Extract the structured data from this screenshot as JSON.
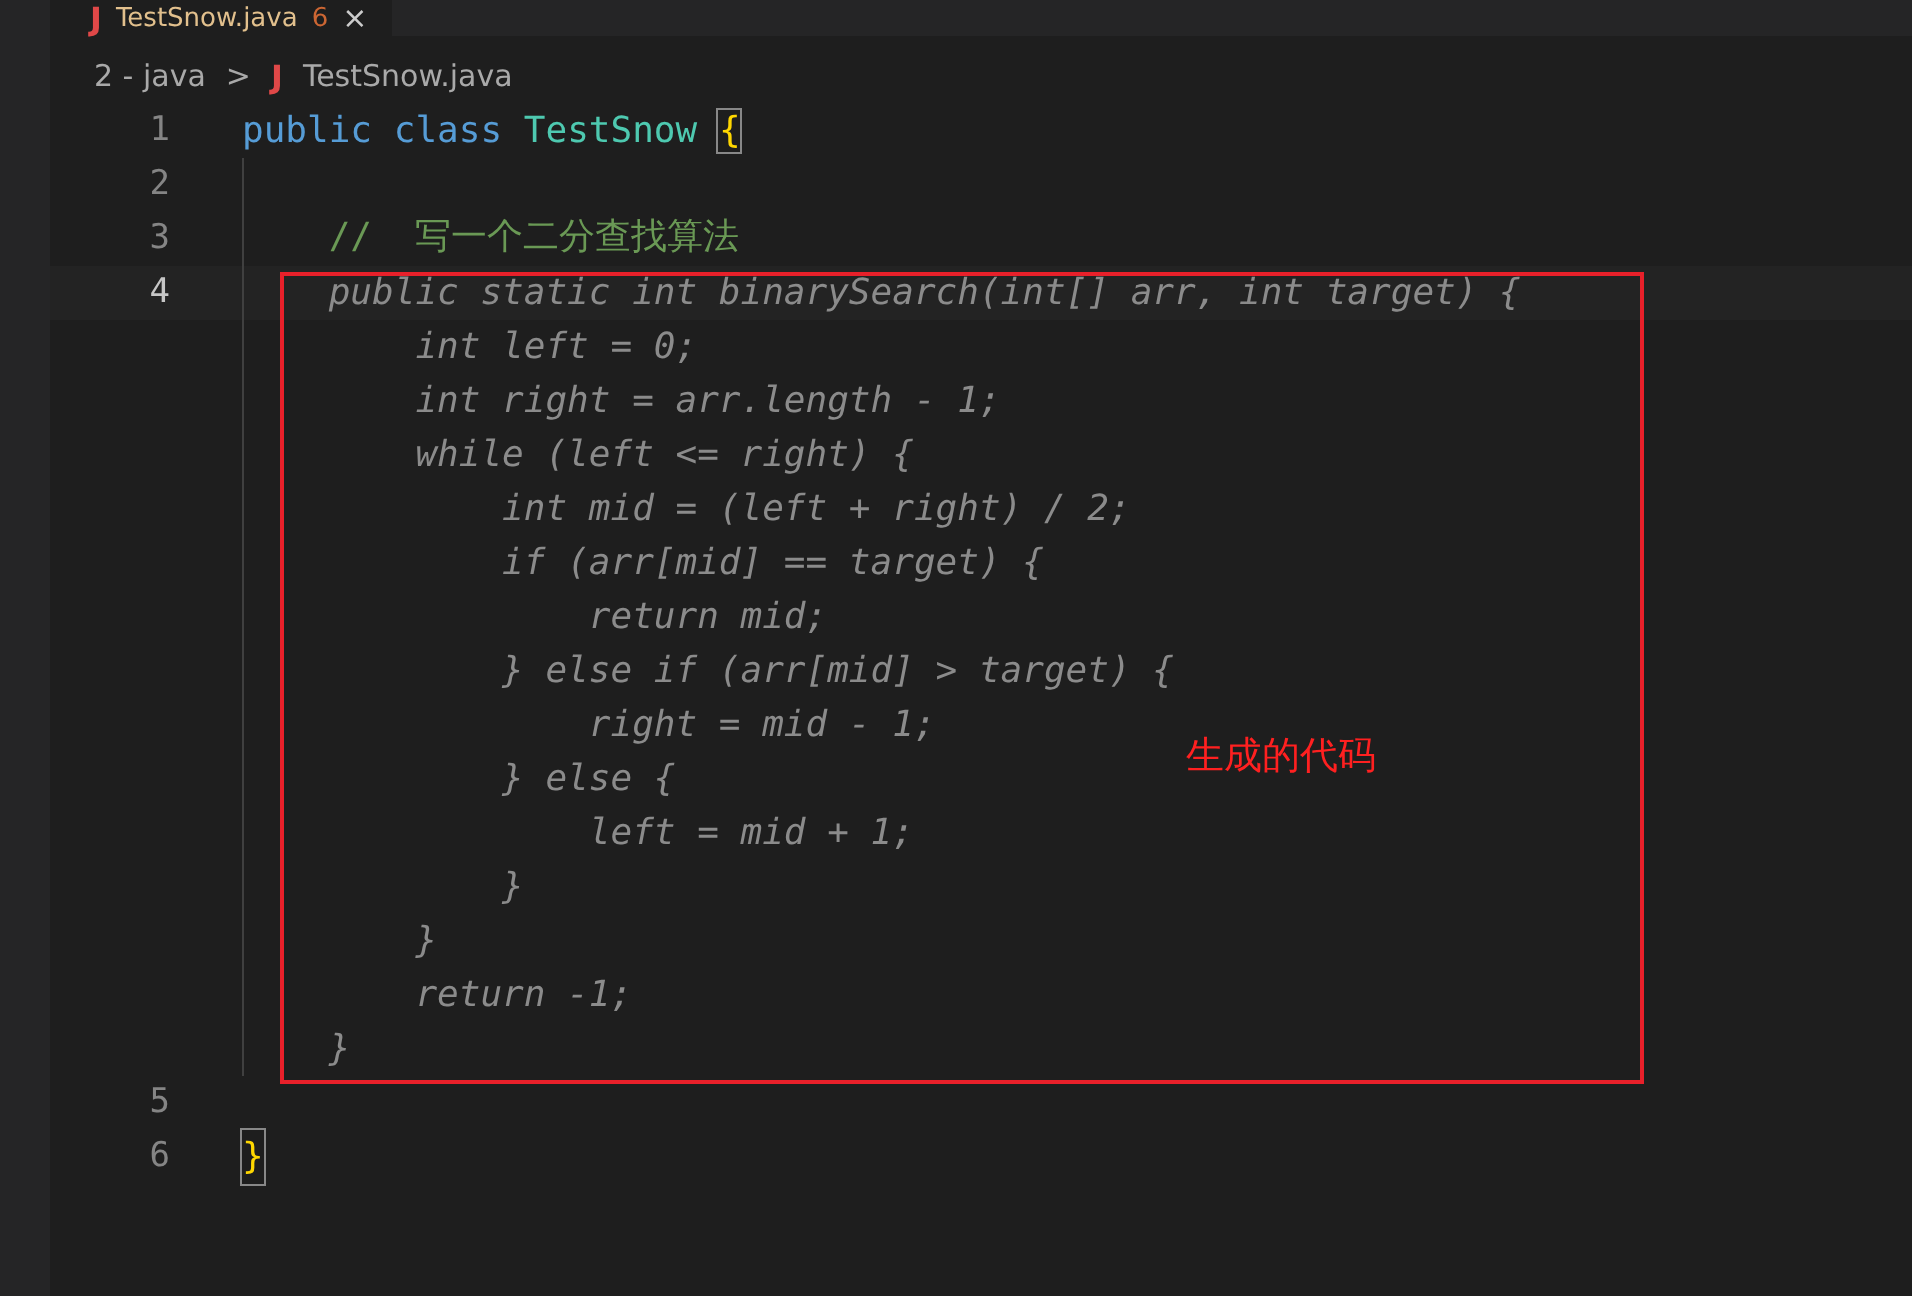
{
  "tab": {
    "icon": "J",
    "title": "TestSnow.java",
    "problems": "6",
    "close": "×",
    "selected": true
  },
  "breadcrumb": {
    "folder": "2 - java",
    "separator": ">",
    "file_icon": "J",
    "file": "TestSnow.java"
  },
  "lines": [
    {
      "number": "1",
      "current": false,
      "tokens": [
        {
          "text": "public class",
          "kind": "keyword"
        },
        {
          "text": "TestSnow",
          "kind": "type"
        },
        {
          "text": "{",
          "kind": "bracket"
        }
      ]
    },
    {
      "number": "2",
      "current": false
    },
    {
      "number": "3",
      "current": false,
      "tokens": [
        {
          "text": "    //  写一个二分查找算法",
          "kind": "comment"
        }
      ]
    },
    {
      "number": "4",
      "current": true,
      "tokens": [
        {
          "text": "    public static int binarySearch(int[] arr, int target) {",
          "kind": "ghost"
        }
      ]
    },
    {
      "current": false,
      "tokens": [
        {
          "text": "        int left = 0;",
          "kind": "ghost"
        }
      ]
    },
    {
      "current": false,
      "tokens": [
        {
          "text": "        int right = arr.length - 1;",
          "kind": "ghost"
        }
      ]
    },
    {
      "current": false,
      "tokens": [
        {
          "text": "        while (left <= right) {",
          "kind": "ghost"
        }
      ]
    },
    {
      "current": false,
      "tokens": [
        {
          "text": "            int mid = (left + right) / 2;",
          "kind": "ghost"
        }
      ]
    },
    {
      "current": false,
      "tokens": [
        {
          "text": "            if (arr[mid] == target) {",
          "kind": "ghost"
        }
      ]
    },
    {
      "current": false,
      "tokens": [
        {
          "text": "                return mid;",
          "kind": "ghost"
        }
      ]
    },
    {
      "current": false,
      "tokens": [
        {
          "text": "            } else if (arr[mid] > target) {",
          "kind": "ghost"
        }
      ]
    },
    {
      "current": false,
      "tokens": [
        {
          "text": "                right = mid - 1;",
          "kind": "ghost"
        }
      ]
    },
    {
      "current": false,
      "tokens": [
        {
          "text": "            } else {",
          "kind": "ghost"
        }
      ]
    },
    {
      "current": false,
      "tokens": [
        {
          "text": "                left = mid + 1;",
          "kind": "ghost"
        }
      ]
    },
    {
      "current": false,
      "tokens": [
        {
          "text": "            }",
          "kind": "ghost"
        }
      ]
    },
    {
      "current": false,
      "tokens": [
        {
          "text": "        }",
          "kind": "ghost"
        }
      ]
    },
    {
      "current": false,
      "tokens": [
        {
          "text": "        return -1;",
          "kind": "ghost"
        }
      ]
    },
    {
      "current": false,
      "tokens": [
        {
          "text": "    }",
          "kind": "ghost"
        }
      ]
    },
    {
      "number": "5",
      "current": false
    },
    {
      "number": "6",
      "current": false,
      "tokens": [
        {
          "text": "}",
          "kind": "bracket"
        }
      ]
    }
  ],
  "annotation": {
    "label": "生成的代码"
  }
}
